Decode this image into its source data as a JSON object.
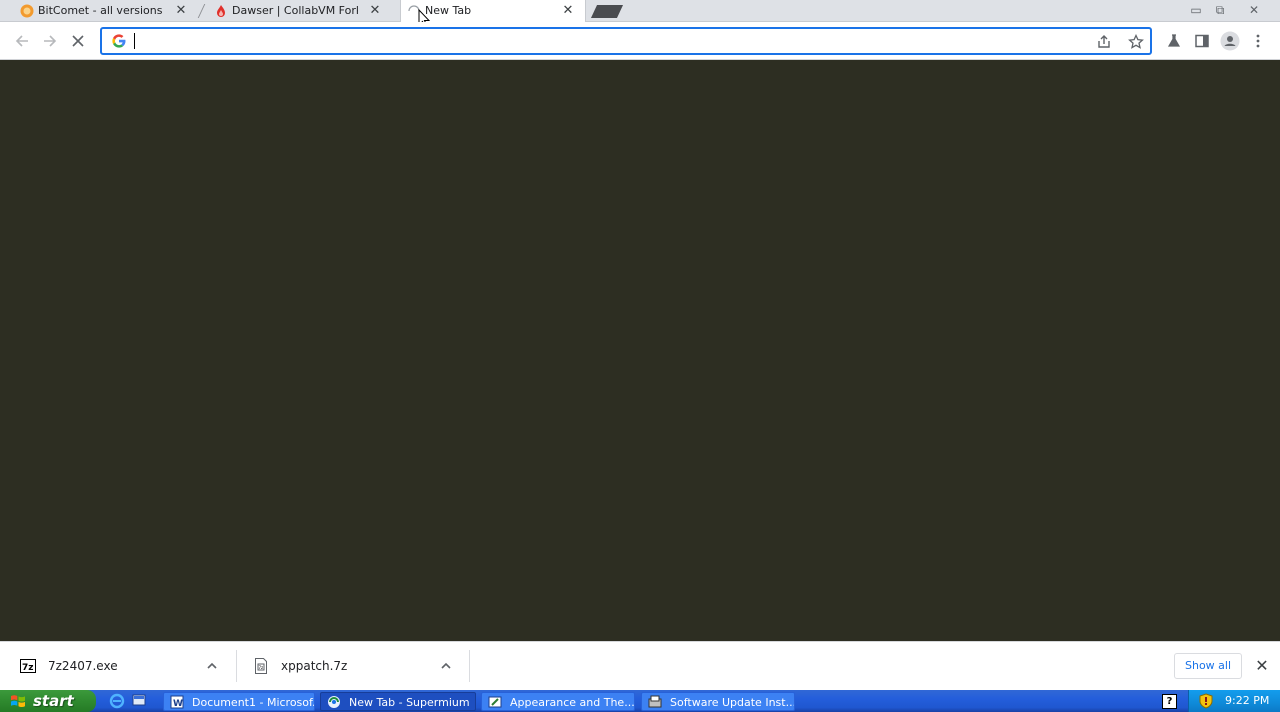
{
  "browser": {
    "tabs": [
      {
        "title": "BitComet - all versions an",
        "icon": "bitcomet-icon",
        "active": false
      },
      {
        "title": "Dawser | CollabVM Forkie",
        "icon": "flame-icon",
        "active": false
      },
      {
        "title": "New Tab",
        "icon": "loading-icon",
        "active": true
      }
    ],
    "omnibox": {
      "value": "",
      "placeholder": ""
    }
  },
  "downloads": {
    "items": [
      {
        "name": "7z2407.exe",
        "icon": "7zip-icon"
      },
      {
        "name": "xppatch.7z",
        "icon": "archive-icon"
      }
    ],
    "show_all_label": "Show all"
  },
  "taskbar": {
    "start_label": "start",
    "tasks": [
      {
        "label": "Document1 - Microsof...",
        "icon": "word-icon",
        "active": false
      },
      {
        "label": "New Tab - Supermium",
        "icon": "supermium-icon",
        "active": true
      },
      {
        "label": "Appearance and The...",
        "icon": "control-panel-icon",
        "active": false
      },
      {
        "label": "Software Update Inst...",
        "icon": "installer-icon",
        "active": false
      }
    ],
    "clock": "9:22 PM"
  },
  "colors": {
    "page_background": "#2d2e22",
    "accent": "#1a73e8",
    "taskbar_blue": "#245edb",
    "start_green": "#2f8a2f"
  }
}
